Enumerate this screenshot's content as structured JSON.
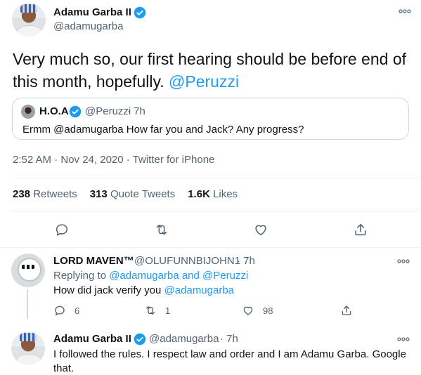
{
  "main_tweet": {
    "name": "Adamu Garba II",
    "handle": "@adamugarba",
    "text_before": "Very much so, our first hearing should be before end of this month, hopefully. ",
    "text_mention": "@Peruzzi",
    "quote": {
      "name": "H.O.A",
      "handle": "@Peruzzi",
      "time": "· 7h",
      "text": "Ermm @adamugarba How far you and Jack? Any progress?"
    },
    "meta": "2:52 AM · Nov 24, 2020 · Twitter for iPhone",
    "stats": {
      "retweets_count": "238",
      "retweets_label": "Retweets",
      "quotes_count": "313",
      "quotes_label": "Quote Tweets",
      "likes_count": "1.6K",
      "likes_label": "Likes"
    }
  },
  "reply1": {
    "name": "LORD MAVEN™",
    "handle": "@OLUFUNNBIJOHN1",
    "time": "· 7h",
    "replying_prefix": "Replying to ",
    "replying_to": "@adamugarba and @Peruzzi",
    "text_before": "How did jack verify you ",
    "text_mention": "@adamugarba",
    "reply_count": "6",
    "retweet_count": "1",
    "like_count": "98"
  },
  "reply2": {
    "name": "Adamu Garba II",
    "handle": "@adamugarba",
    "time": "· 7h",
    "text_line1": "I followed the rules. I respect law and order and I am Adamu Garba. Google",
    "text_line2": "that."
  },
  "colors": {
    "accent": "#1d9bf0",
    "secondary_text": "#536471",
    "primary_text": "#0f1419"
  },
  "icons": [
    "verified-badge-icon",
    "more-icon",
    "reply-icon",
    "retweet-icon",
    "like-icon",
    "share-icon"
  ]
}
